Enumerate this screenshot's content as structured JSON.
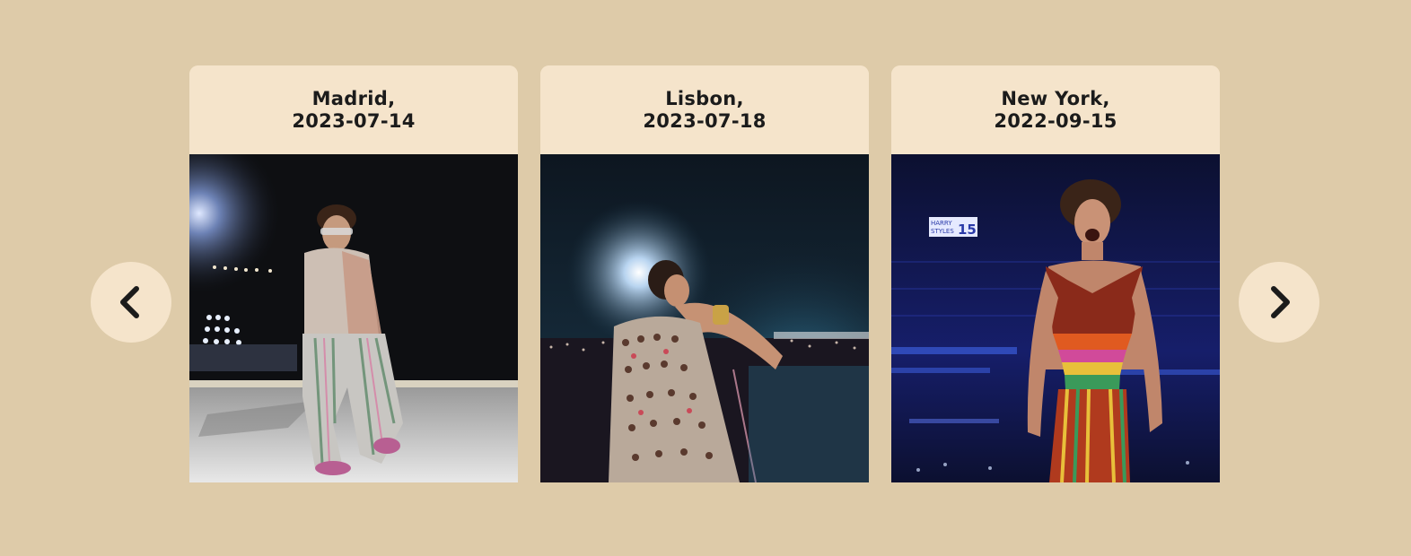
{
  "carousel": {
    "prev_icon": "chevron-left-icon",
    "next_icon": "chevron-right-icon",
    "cards": [
      {
        "city": "Madrid,",
        "date": "2023-07-14"
      },
      {
        "city": "Lisbon,",
        "date": "2023-07-18"
      },
      {
        "city": "New York,",
        "date": "2022-09-15"
      }
    ],
    "photo_3_sign": {
      "line1": "HARRY",
      "line2": "STYLES",
      "number": "15"
    }
  },
  "colors": {
    "page_background": "#decba9",
    "card_background": "#f5e4cb",
    "text": "#1b1b1b"
  }
}
